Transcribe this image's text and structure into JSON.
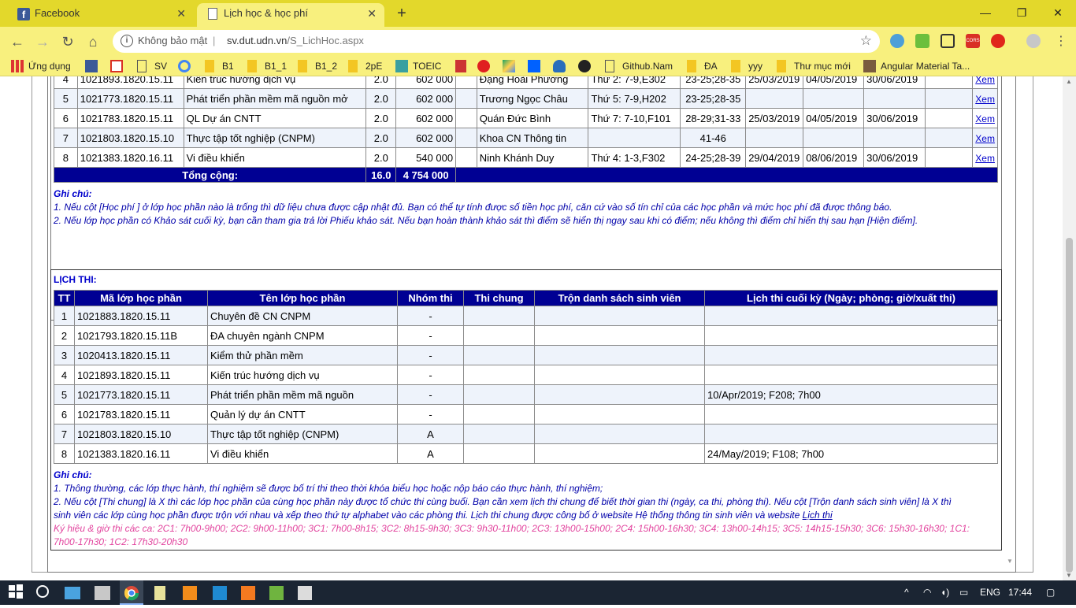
{
  "browser": {
    "tabs": [
      {
        "label": "Facebook",
        "active": false
      },
      {
        "label": "Lịch học & học phí",
        "active": true
      }
    ],
    "security_label": "Không bảo mật",
    "url_host": "sv.dut.udn.vn",
    "url_path": "/S_LichHoc.aspx",
    "bookmarks": [
      "Ứng dụng",
      "SV",
      "B1",
      "B1_1",
      "B1_2",
      "2pE",
      "TOEIC",
      "Github.Nam",
      "ĐA",
      "yyy",
      "Thư mục mới",
      "Angular Material Ta..."
    ]
  },
  "schedule": {
    "rows": [
      {
        "stt": "4",
        "code": "1021893.1820.15.11",
        "name": "Kiến trúc hướng dịch vụ",
        "credits": "2.0",
        "fee": "602 000",
        "teacher": "Đặng Hoài Phương",
        "time": "Thứ 2: 7-9,E302",
        "weeks": "23-25;28-35",
        "d1": "25/03/2019",
        "d2": "04/05/2019",
        "d3": "30/06/2019",
        "link": "Xem"
      },
      {
        "stt": "5",
        "code": "1021773.1820.15.11",
        "name": "Phát triển phần mềm mã nguồn mở",
        "credits": "2.0",
        "fee": "602 000",
        "teacher": "Trương Ngọc Châu",
        "time": "Thứ 5: 7-9,H202",
        "weeks": "23-25;28-35",
        "d1": "",
        "d2": "",
        "d3": "",
        "link": "Xem"
      },
      {
        "stt": "6",
        "code": "1021783.1820.15.11",
        "name": "QL Dự án CNTT",
        "credits": "2.0",
        "fee": "602 000",
        "teacher": "Quán Đức Bình",
        "time": "Thứ 7: 7-10,F101",
        "weeks": "28-29;31-33",
        "d1": "25/03/2019",
        "d2": "04/05/2019",
        "d3": "30/06/2019",
        "link": "Xem"
      },
      {
        "stt": "7",
        "code": "1021803.1820.15.10",
        "name": "Thực tập tốt nghiệp (CNPM)",
        "credits": "2.0",
        "fee": "602 000",
        "teacher": "Khoa CN Thông tin",
        "time": "",
        "weeks": "41-46",
        "d1": "",
        "d2": "",
        "d3": "",
        "link": "Xem"
      },
      {
        "stt": "8",
        "code": "1021383.1820.16.11",
        "name": "Vi điều khiển",
        "credits": "2.0",
        "fee": "540 000",
        "teacher": "Ninh Khánh Duy",
        "time": "Thứ 4: 1-3,F302",
        "weeks": "24-25;28-39",
        "d1": "29/04/2019",
        "d2": "08/06/2019",
        "d3": "30/06/2019",
        "link": "Xem"
      }
    ],
    "total_label": "Tổng cộng:",
    "total_credits": "16.0",
    "total_fee": "4 754 000",
    "notes_head": "Ghi chú:",
    "note1": "1. Nếu cột [Học phí ] ở lớp học phần nào là trống thì dữ liệu chưa được cập nhật đủ. Bạn có thể tự tính được số tiền học phí, căn cứ vào số tín chỉ của các học phần và mức học phí đã được thông báo.",
    "note2": "2. Nếu lớp học phần có Khảo sát cuối kỳ, bạn cần tham gia trả lời Phiếu khảo sát. Nếu bạn hoàn thành khảo sát thì điểm sẽ hiển thị ngay sau khi có điểm; nếu không thì điểm chỉ hiển thị sau hạn [Hiện điểm]."
  },
  "exams": {
    "title": "LỊCH THI:",
    "headers": [
      "TT",
      "Mã lớp học phần",
      "Tên lớp học phần",
      "Nhóm thi",
      "Thi chung",
      "Trộn danh sách sinh viên",
      "Lịch thi cuối kỳ (Ngày; phòng; giờ/xuất thi)"
    ],
    "rows": [
      {
        "tt": "1",
        "code": "1021883.1820.15.11",
        "name": "Chuyên đề CN CNPM",
        "group": "-",
        "common": "",
        "mix": "",
        "schedule": ""
      },
      {
        "tt": "2",
        "code": "1021793.1820.15.11B",
        "name": "ĐA chuyên ngành CNPM",
        "group": "-",
        "common": "",
        "mix": "",
        "schedule": ""
      },
      {
        "tt": "3",
        "code": "1020413.1820.15.11",
        "name": "Kiểm thử phần mềm",
        "group": "-",
        "common": "",
        "mix": "",
        "schedule": ""
      },
      {
        "tt": "4",
        "code": "1021893.1820.15.11",
        "name": "Kiến trúc hướng dịch vụ",
        "group": "-",
        "common": "",
        "mix": "",
        "schedule": ""
      },
      {
        "tt": "5",
        "code": "1021773.1820.15.11",
        "name": "Phát triển phần mềm mã nguồn",
        "group": "-",
        "common": "",
        "mix": "",
        "schedule": "10/Apr/2019; F208; 7h00"
      },
      {
        "tt": "6",
        "code": "1021783.1820.15.11",
        "name": "Quản lý dự án CNTT",
        "group": "-",
        "common": "",
        "mix": "",
        "schedule": ""
      },
      {
        "tt": "7",
        "code": "1021803.1820.15.10",
        "name": "Thực tập tốt nghiệp (CNPM)",
        "group": "A",
        "common": "",
        "mix": "",
        "schedule": ""
      },
      {
        "tt": "8",
        "code": "1021383.1820.16.11",
        "name": "Vi điều khiển",
        "group": "A",
        "common": "",
        "mix": "",
        "schedule": "24/May/2019; F108; 7h00"
      }
    ],
    "notes_head": "Ghi chú:",
    "note1": "1. Thông thường, các lớp thực hành, thí nghiệm sẽ được bố trí thi theo thời khóa biểu học hoặc nộp báo cáo thực hành, thí nghiệm;",
    "note2a": "2. Nếu cột [Thi chung] là X thì các lớp học phần của cùng học phần này được tổ chức thi cùng buổi. Bạn cần xem lịch thi chung để biết thời gian thi (ngày, ca thi, phòng thi). Nếu cột [Trộn danh sách sinh viên] là X thì",
    "note2b": "sinh viên các lớp cùng học phần được trộn với nhau và xếp theo thứ tự alphabet vào các phòng thi. Lịch thi chung được công bố ở website Hệ thống thông tin sinh viên và website",
    "note2_link": "Lịch thi",
    "note3a": "Ký hiệu & giờ thi các ca: 2C1: 7h00-9h00; 2C2: 9h00-11h00; 3C1: 7h00-8h15; 3C2: 8h15-9h30; 3C3: 9h30-11h00; 2C3: 13h00-15h00; 2C4: 15h00-16h30; 3C4: 13h00-14h15; 3C5: 14h15-15h30; 3C6: 15h30-16h30; 1C1:",
    "note3b": "7h00-17h30; 1C2: 17h30-20h30"
  },
  "taskbar": {
    "lang": "ENG",
    "time": "17:44"
  },
  "colors": {
    "chrome_tab_bg": "#e3d82b",
    "chrome_toolbar_bg": "#f8f07e",
    "header_blue": "#000093",
    "note_pink": "#e2449e",
    "taskbar_bg": "#1b2533"
  }
}
